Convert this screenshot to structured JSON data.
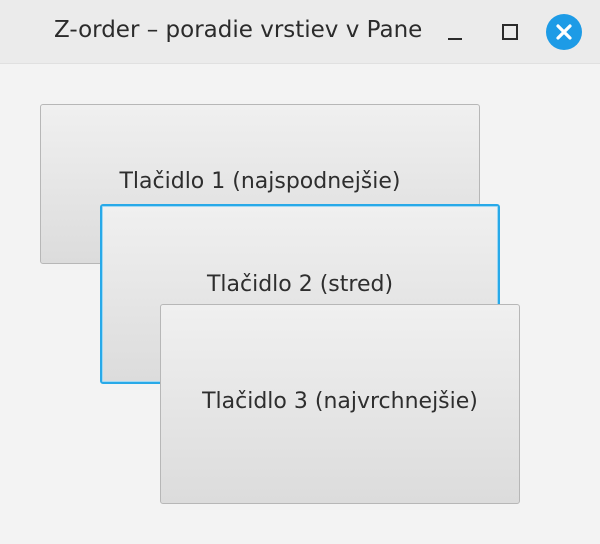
{
  "window": {
    "title": "Z-order – poradie vrstiev v Pane",
    "controls": {
      "minimize_icon": "minimize-icon",
      "maximize_icon": "maximize-icon",
      "close_icon": "close-icon",
      "close_color": "#1d9be6"
    }
  },
  "pane": {
    "buttons": [
      {
        "label": "Tlačidlo 1 (najspodnejšie)"
      },
      {
        "label": "Tlačidlo 2 (stred)",
        "focused": true,
        "focus_color": "#28a9e8"
      },
      {
        "label": "Tlačidlo 3 (najvrchnejšie)"
      }
    ]
  }
}
